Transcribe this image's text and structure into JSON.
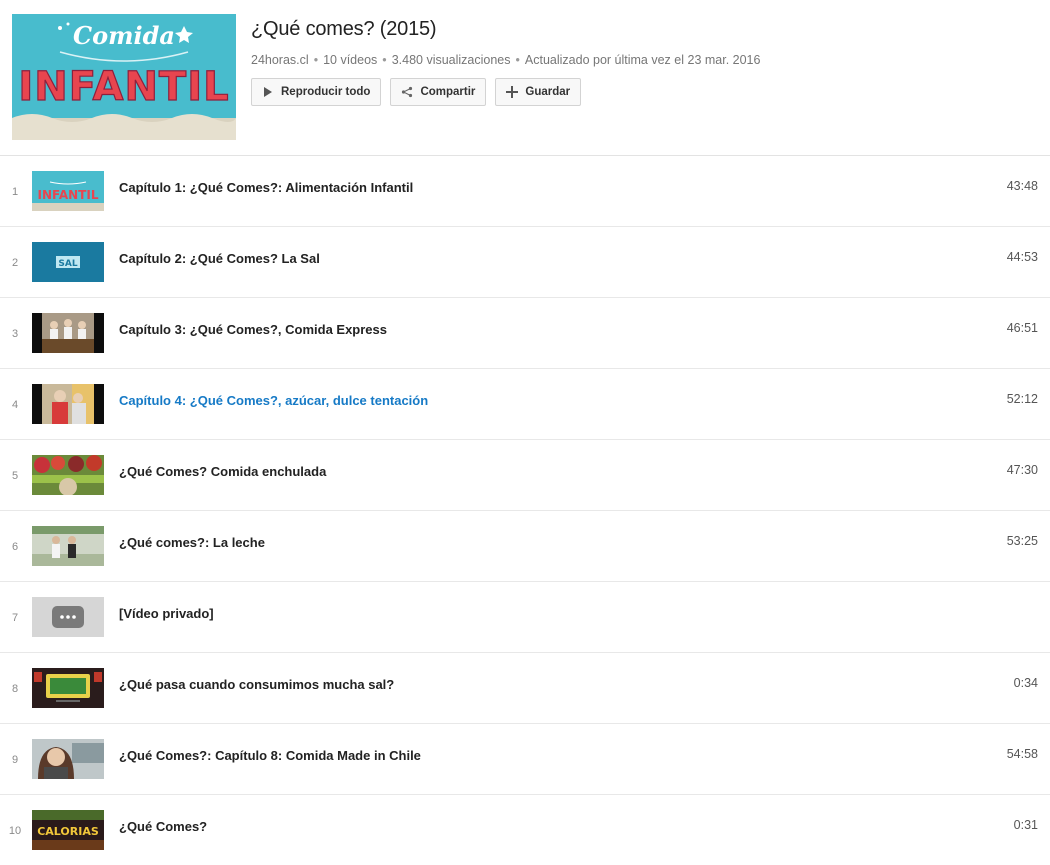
{
  "playlist": {
    "title": "¿Qué comes? (2015)",
    "channel": "24horas.cl",
    "video_count": "10 vídeos",
    "views": "3.480 visualizaciones",
    "updated": "Actualizado por última vez el 23 mar. 2016",
    "thumb_word_1": "Comida",
    "thumb_word_2": "INFANTIL"
  },
  "actions": {
    "play_all": "Reproducir todo",
    "share": "Compartir",
    "save": "Guardar"
  },
  "colors": {
    "active_title": "#167ac6",
    "thumb_bg": "#3fb6c9"
  },
  "videos": [
    {
      "index": "1",
      "title": "Capítulo 1: ¿Qué Comes?: Alimentación Infantil",
      "duration": "43:48",
      "thumb_label": "INFANTIL"
    },
    {
      "index": "2",
      "title": "Capítulo 2: ¿Qué Comes? La Sal",
      "duration": "44:53",
      "thumb_label": "SAL"
    },
    {
      "index": "3",
      "title": "Capítulo 3: ¿Qué Comes?, Comida Express",
      "duration": "46:51"
    },
    {
      "index": "4",
      "title": "Capítulo 4: ¿Qué Comes?, azúcar, dulce tentación",
      "duration": "52:12"
    },
    {
      "index": "5",
      "title": "¿Qué Comes? Comida enchulada",
      "duration": "47:30"
    },
    {
      "index": "6",
      "title": "¿Qué comes?: La leche",
      "duration": "53:25"
    },
    {
      "index": "7",
      "title": "[Vídeo privado]",
      "duration": ""
    },
    {
      "index": "8",
      "title": "¿Qué pasa cuando consumimos mucha sal?",
      "duration": "0:34"
    },
    {
      "index": "9",
      "title": "¿Qué Comes?: Capítulo 8: Comida Made in Chile",
      "duration": "54:58"
    },
    {
      "index": "10",
      "title": "¿Qué Comes?",
      "duration": "0:31",
      "thumb_label": "CALORIAS"
    }
  ]
}
